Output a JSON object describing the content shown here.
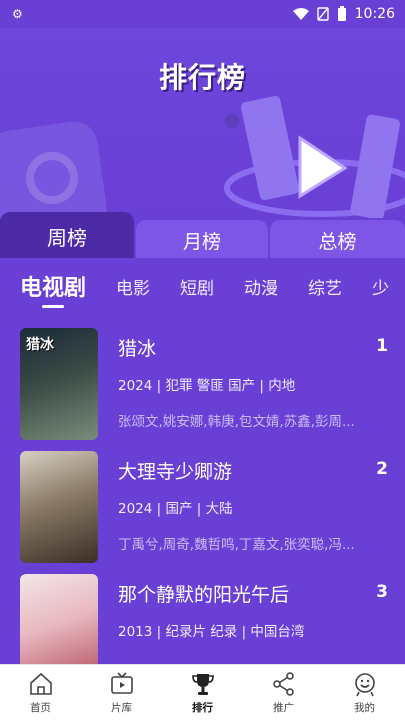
{
  "status_bar": {
    "time": "10:26"
  },
  "hero": {
    "title": "排行榜"
  },
  "period_tabs": [
    {
      "label": "周榜",
      "active": true
    },
    {
      "label": "月榜",
      "active": false
    },
    {
      "label": "总榜",
      "active": false
    }
  ],
  "categories": [
    {
      "label": "电视剧",
      "active": true
    },
    {
      "label": "电影"
    },
    {
      "label": "短剧"
    },
    {
      "label": "动漫"
    },
    {
      "label": "综艺"
    },
    {
      "label": "少"
    }
  ],
  "rankings": [
    {
      "rank": "1",
      "title": "猎冰",
      "poster_text": "猎冰",
      "meta": "2024 | 犯罪 警匪 国产 | 内地",
      "cast": "张颂文,姚安娜,韩庚,包文婧,苏鑫,彭周..."
    },
    {
      "rank": "2",
      "title": "大理寺少卿游",
      "poster_text": "",
      "meta": "2024 | 国产 | 大陆",
      "cast": "丁禹兮,周奇,魏哲鸣,丁嘉文,张奕聪,冯..."
    },
    {
      "rank": "3",
      "title": "那个静默的阳光午后",
      "poster_text": "",
      "meta": "2013 | 纪录片 纪录 | 中国台湾",
      "cast": ""
    }
  ],
  "bottom_nav": [
    {
      "label": "首页",
      "icon": "home-icon"
    },
    {
      "label": "片库",
      "icon": "tv-icon"
    },
    {
      "label": "排行",
      "icon": "trophy-icon",
      "active": true
    },
    {
      "label": "推广",
      "icon": "share-icon"
    },
    {
      "label": "我的",
      "icon": "profile-icon"
    }
  ]
}
